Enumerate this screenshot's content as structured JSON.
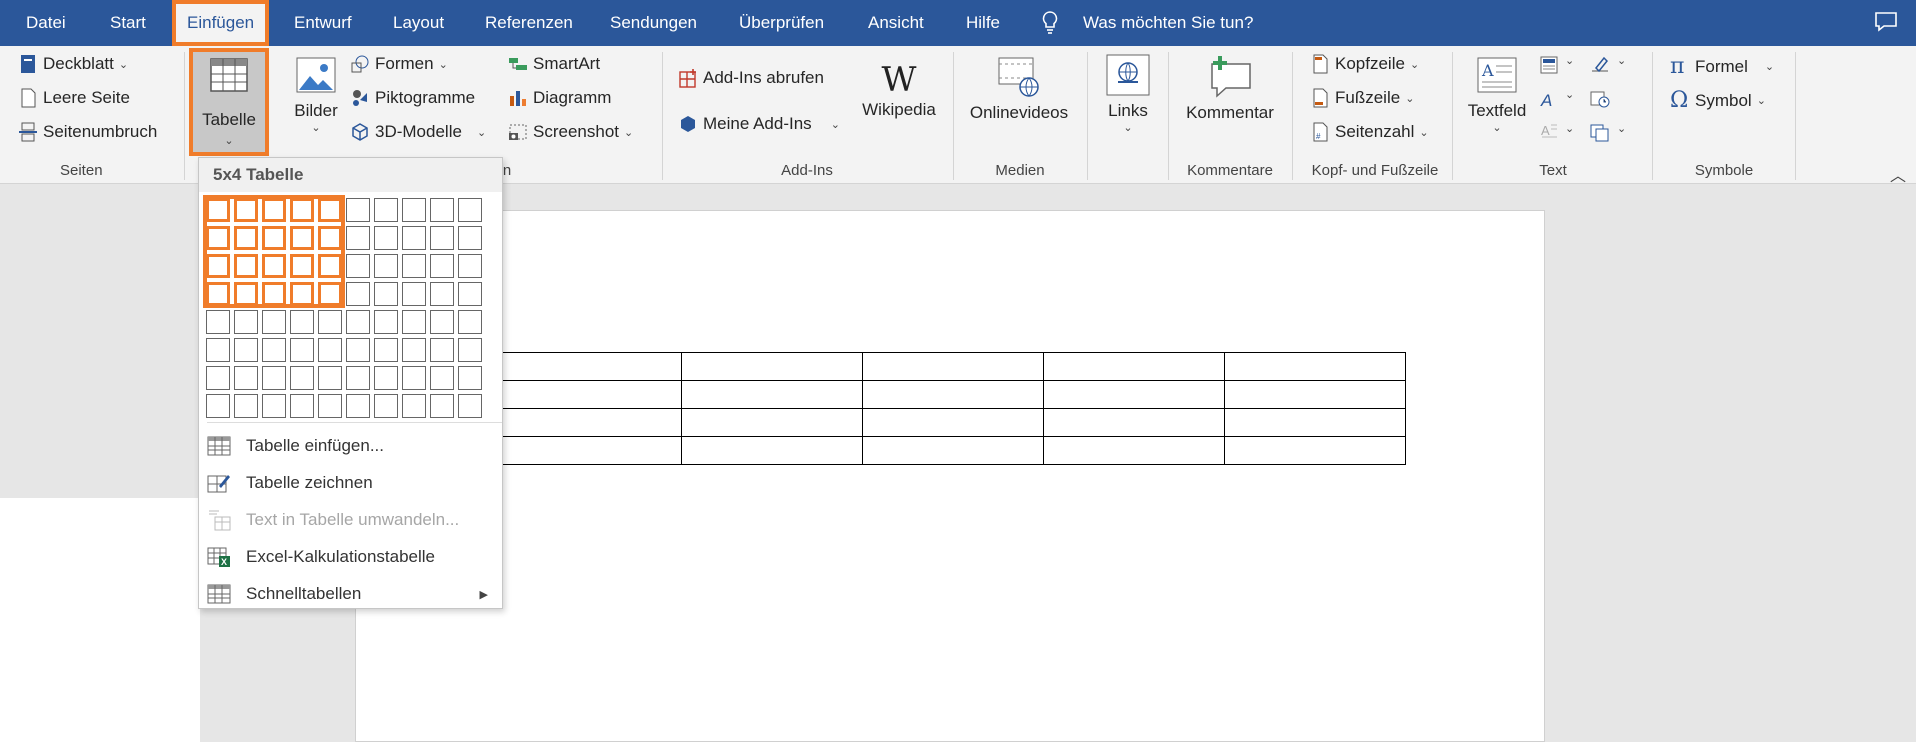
{
  "tabs": [
    "Datei",
    "Start",
    "Einfügen",
    "Entwurf",
    "Layout",
    "Referenzen",
    "Sendungen",
    "Überprüfen",
    "Ansicht",
    "Hilfe"
  ],
  "tell_me": "Was möchten Sie tun?",
  "ribbon": {
    "seiten": {
      "items": [
        "Deckblatt",
        "Leere Seite",
        "Seitenumbruch"
      ],
      "label": "Seiten"
    },
    "tabelle": "Tabelle",
    "bilder": "Bilder",
    "illustrationen": {
      "items": [
        "Formen",
        "Piktogramme",
        "3D-Modelle",
        "SmartArt",
        "Diagramm",
        "Screenshot"
      ],
      "label_tail": "n"
    },
    "addins": {
      "get": "Add-Ins abrufen",
      "my": "Meine Add-Ins",
      "wikipedia": "Wikipedia",
      "label": "Add-Ins"
    },
    "medien": {
      "video": "Onlinevideos",
      "label": "Medien"
    },
    "links": "Links",
    "kommentare": {
      "btn": "Kommentar",
      "label": "Kommentare"
    },
    "kopf": {
      "items": [
        "Kopfzeile",
        "Fußzeile",
        "Seitenzahl"
      ],
      "label": "Kopf- und Fußzeile"
    },
    "text": {
      "textfeld": "Textfeld",
      "label": "Text"
    },
    "symbole": {
      "formel": "Formel",
      "symbol": "Symbol",
      "label": "Symbole"
    }
  },
  "dropdown": {
    "title": "5x4 Tabelle",
    "grid_cols": 10,
    "grid_rows": 8,
    "selected_cols": 5,
    "selected_rows": 4,
    "items": [
      {
        "label": "Tabelle einfügen...",
        "enabled": true
      },
      {
        "label": "Tabelle zeichnen",
        "enabled": true
      },
      {
        "label": "Text in Tabelle umwandeln...",
        "enabled": false
      },
      {
        "label": "Excel-Kalkulationstabelle",
        "enabled": true
      },
      {
        "label": "Schnelltabellen",
        "enabled": true,
        "submenu": true
      }
    ]
  },
  "document": {
    "table_rows": 4,
    "table_cols": 5
  },
  "colors": {
    "ribbon_blue": "#2b579a",
    "highlight_orange": "#f07c2a"
  }
}
